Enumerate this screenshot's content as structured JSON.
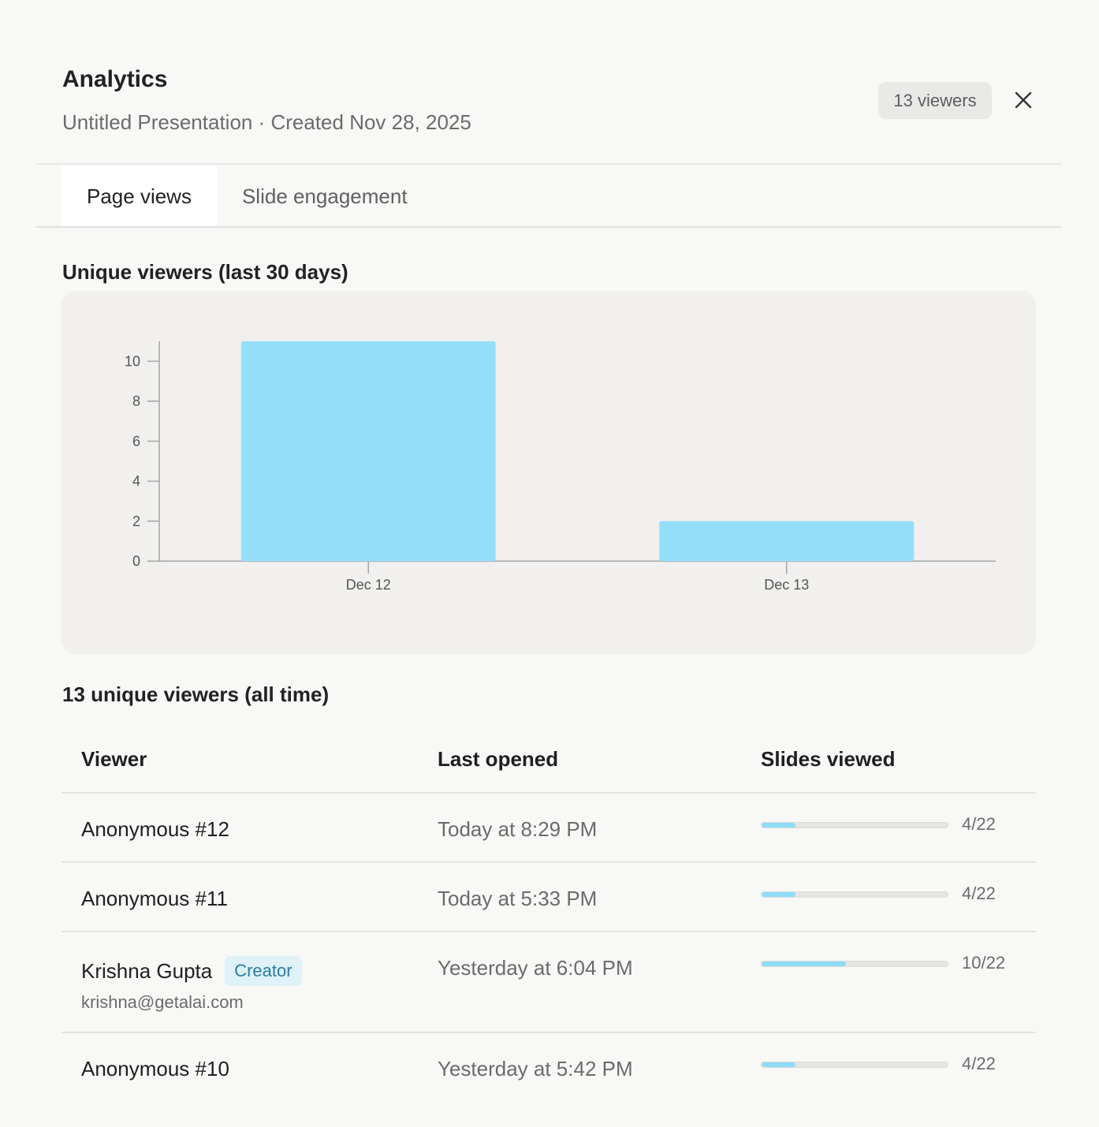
{
  "header": {
    "title": "Analytics",
    "subtitle": "Untitled Presentation · Created Nov 28, 2025",
    "viewers_badge": "13 viewers",
    "close_icon": "close-icon"
  },
  "tabs": [
    {
      "label": "Page views",
      "active": true
    },
    {
      "label": "Slide engagement",
      "active": false
    }
  ],
  "chart_section": {
    "title": "Unique viewers (last 30 days)"
  },
  "chart_data": {
    "type": "bar",
    "categories": [
      "Dec 12",
      "Dec 13"
    ],
    "values": [
      11,
      2
    ],
    "yticks": [
      "0",
      "2",
      "4",
      "6",
      "8",
      "10"
    ],
    "ylim": [
      0,
      11
    ],
    "bar_color": "#95dffb",
    "grid": false
  },
  "viewers_section": {
    "title": "13 unique viewers (all time)"
  },
  "table": {
    "headers": {
      "viewer": "Viewer",
      "last_opened": "Last opened",
      "slides_viewed": "Slides viewed"
    },
    "rows": [
      {
        "name": "Anonymous #12",
        "badge": null,
        "email": null,
        "last_opened": "Today at 8:29 PM",
        "slides_viewed": "4/22",
        "progress": 0.1818
      },
      {
        "name": "Anonymous #11",
        "badge": null,
        "email": null,
        "last_opened": "Today at 5:33 PM",
        "slides_viewed": "4/22",
        "progress": 0.1818
      },
      {
        "name": "Krishna Gupta",
        "badge": "Creator",
        "email": "krishna@getalai.com",
        "last_opened": "Yesterday at 6:04 PM",
        "slides_viewed": "10/22",
        "progress": 0.4545
      },
      {
        "name": "Anonymous #10",
        "badge": null,
        "email": null,
        "last_opened": "Yesterday at 5:42 PM",
        "slides_viewed": "4/22",
        "progress": 0.1818
      }
    ]
  }
}
